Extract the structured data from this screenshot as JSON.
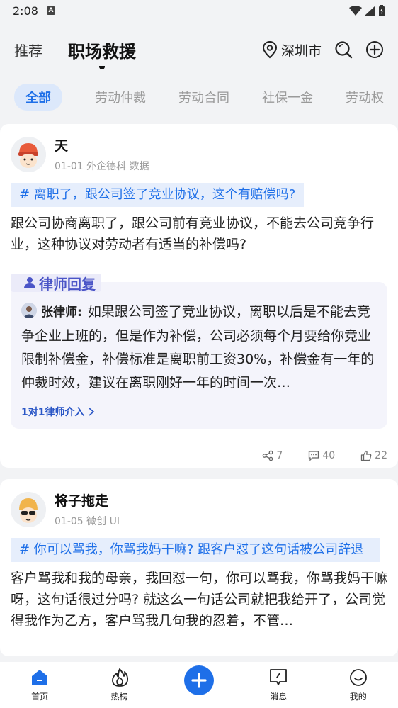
{
  "status_bar": {
    "time": "2:08",
    "badge": "A"
  },
  "header": {
    "tab_recommend": "推荐",
    "tab_main": "职场救援",
    "location": "深圳市"
  },
  "categories": [
    "全部",
    "劳动仲裁",
    "劳动合同",
    "社保一金",
    "劳动权"
  ],
  "posts": [
    {
      "user": "天",
      "meta": "01-01 外企德科 数据",
      "topic": "# 离职了，跟公司签了竞业协议，这个有赔偿吗?",
      "body": "跟公司协商离职了，跟公司前有竞业协议，不能去公司竞争行业，这种协议对劳动者有适当的补偿吗?",
      "lawyer_title": "律师回复",
      "lawyer_name": "张律师:",
      "lawyer_answer": "如果跟公司签了竞业协议，离职以后是不能去竞争企业上班的，但是作为补偿，公司必须每个月要给你竞业限制补偿金，补偿标准是离职前工资30%，补偿金有一年的仲裁时效，建议在离职刚好一年的时间一次…",
      "consult_link": "1对1律师介入",
      "shares": "7",
      "comments": "40",
      "likes": "22"
    },
    {
      "user": "将子拖走",
      "meta": "01-05 微创 UI",
      "topic": "# 你可以骂我，你骂我妈干嘛? 跟客户怼了这句话被公司辞退",
      "body": "客户骂我和我的母亲，我回怼一句，你可以骂我，你骂我妈干嘛呀，这句话很过分吗? 就这么一句话公司就把我给开了，公司觉得我作为乙方，客户骂我几句我的忍着，不管…"
    }
  ],
  "bottom_nav": {
    "home": "首页",
    "hot": "热榜",
    "messages": "消息",
    "mine": "我的"
  },
  "colors": {
    "accent": "#1e6fe8",
    "lawyer": "#4b55c7"
  }
}
